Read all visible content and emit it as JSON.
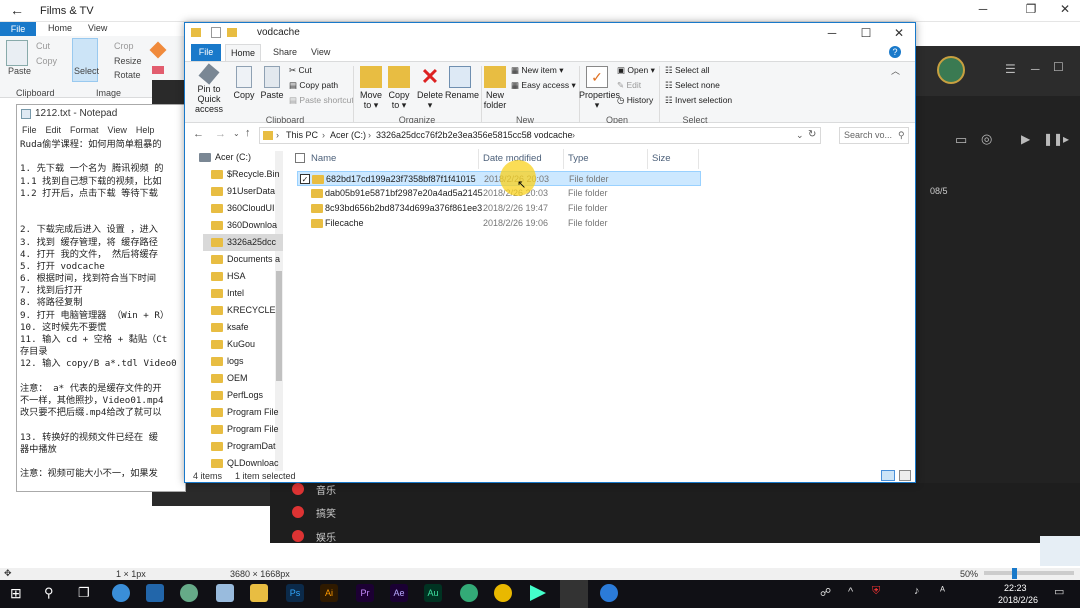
{
  "films_tv": {
    "title": "Films & TV",
    "back_icon": "back-arrow-icon"
  },
  "paint": {
    "tabs": [
      "File",
      "Home",
      "View"
    ],
    "clipboard_group": "Clipboard",
    "image_group": "Image",
    "paste": "Paste",
    "cut": "Cut",
    "copy": "Copy",
    "select": "Select",
    "crop": "Crop",
    "resize": "Resize",
    "rotate": "Rotate",
    "status_size": "1 × 1px",
    "status_dims": "3680 × 1668px",
    "zoom": "50%"
  },
  "notepad": {
    "title": "1212.txt - Notepad",
    "menu": [
      "File",
      "Edit",
      "Format",
      "View",
      "Help"
    ],
    "lines": [
      "Ruda偷学课程：如何用简单粗暴的",
      "",
      "1. 先下载 一个名为 腾讯视频 的",
      "1.1 找到自己想下载的视频，比如",
      "1.2 打开后，点击下载 等待下载",
      "",
      "",
      "2. 下载完成后进入 设置 ，进入",
      "3. 找到 缓存管理，将 缓存路径",
      "4. 打开 我的文件， 然后将缓存",
      "5. 打开 vodcache",
      "6. 根据时间，找到符合当下时间",
      "7. 找到后打开",
      "8. 将路径复制",
      "9. 打开 电脑管理器 （Win + R）",
      "10. 这时候先不要慌",
      "11. 输入 cd + 空格 + 黏贴（Ct",
      "存目录",
      "12. 输入 copy/B a*.tdl Video0",
      "",
      "注意： a* 代表的是缓存文件的开",
      "不一样，其他照抄，Video01.mp4",
      "改只要不把后缀.mp4给改了就可以",
      "",
      "13. 转换好的视频文件已经在 缓",
      "器中播放",
      "",
      "注意：视频可能大小不一，如果发"
    ]
  },
  "media_player": {
    "counter": "08/5",
    "menu_items": [
      "音乐",
      "搞笑",
      "娱乐"
    ]
  },
  "explorer": {
    "title": "vodcache",
    "tabs": [
      "File",
      "Home",
      "Share",
      "View"
    ],
    "ribbon": {
      "pin": "Pin to Quick access",
      "copy": "Copy",
      "paste": "Paste",
      "cut": "Cut",
      "copy_path": "Copy path",
      "paste_shortcut": "Paste shortcut",
      "clipboard": "Clipboard",
      "move_to": "Move to",
      "copy_to": "Copy to",
      "delete": "Delete",
      "rename": "Rename",
      "organize": "Organize",
      "new_folder": "New folder",
      "new_item": "New item",
      "easy_access": "Easy access",
      "new": "New",
      "properties": "Properties",
      "open": "Open",
      "edit": "Edit",
      "history": "History",
      "open_group": "Open",
      "select_all": "Select all",
      "select_none": "Select none",
      "invert_selection": "Invert selection",
      "select_group": "Select"
    },
    "breadcrumb": [
      "This PC",
      "Acer (C:)",
      "3326a25dcc76f2b2e3ea356e5815cc58",
      "vodcache"
    ],
    "search_placeholder": "Search vo...",
    "nav_items": [
      "Acer (C:)",
      "$Recycle.Bin",
      "91UserData",
      "360CloudUI",
      "360Downloa",
      "3326a25dcc",
      "Documents a",
      "HSA",
      "Intel",
      "KRECYCLE",
      "ksafe",
      "KuGou",
      "logs",
      "OEM",
      "PerfLogs",
      "Program File",
      "Program File",
      "ProgramDat",
      "QLDownloac"
    ],
    "columns": [
      "Name",
      "Date modified",
      "Type",
      "Size"
    ],
    "rows": [
      {
        "name": "682bd17cd199a23f7358bf87f1f41015",
        "date": "2018/2/26 20:03",
        "type": "File folder"
      },
      {
        "name": "dab05b91e5871bf2987e20a4ad5a2145",
        "date": "2018/2/26 20:03",
        "type": "File folder"
      },
      {
        "name": "8c93bd656b2bd8734d699a376f861ee3",
        "date": "2018/2/26 19:47",
        "type": "File folder"
      },
      {
        "name": "Filecache",
        "date": "2018/2/26 19:06",
        "type": "File folder"
      }
    ],
    "status_items": "4 items",
    "status_selected": "1 item selected"
  },
  "taskbar": {
    "time": "22:23",
    "date": "2018/2/26"
  }
}
